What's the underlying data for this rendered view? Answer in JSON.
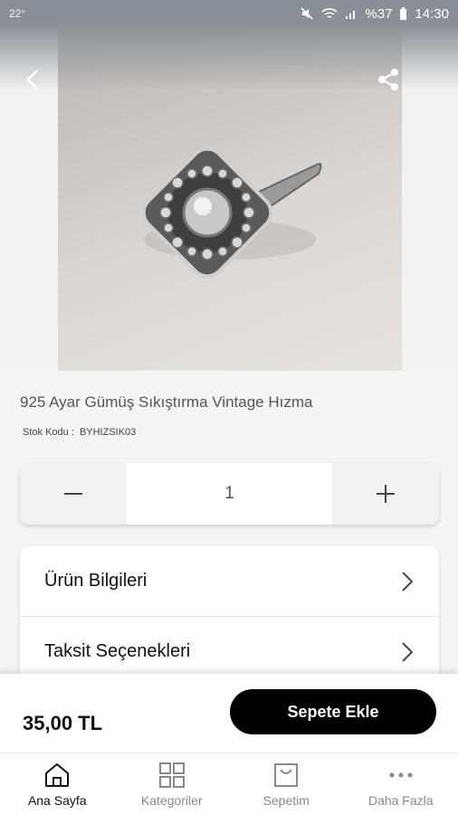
{
  "status_bar": {
    "temperature": "22°",
    "battery": "%37",
    "time": "14:30"
  },
  "product": {
    "title": "925 Ayar Gümüş Sıkıştırma Vintage Hızma",
    "sku_label": "Stok Kodu :",
    "sku_value": "BYHIZSIK03",
    "image_icon": "ring-photo"
  },
  "quantity": {
    "value": "1",
    "decrease_icon": "minus-icon",
    "increase_icon": "plus-icon"
  },
  "info_rows": [
    {
      "label": "Ürün Bilgileri"
    },
    {
      "label": "Taksit Seçenekleri"
    }
  ],
  "purchase": {
    "price": "35,00 TL",
    "add_to_cart_label": "Sepete Ekle"
  },
  "bottom_nav": [
    {
      "label": "Ana Sayfa",
      "icon": "home-icon",
      "active": true
    },
    {
      "label": "Kategoriler",
      "icon": "grid-icon",
      "active": false
    },
    {
      "label": "Sepetim",
      "icon": "bag-icon",
      "active": false
    },
    {
      "label": "Daha Fazla",
      "icon": "more-icon",
      "active": false
    }
  ],
  "colors": {
    "accent": "#000000",
    "active_nav": "#111111",
    "inactive_nav": "#888888"
  }
}
